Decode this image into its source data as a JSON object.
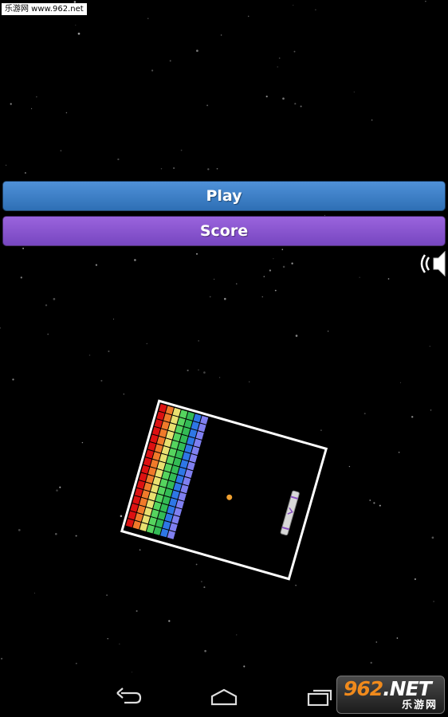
{
  "watermark": {
    "top_text": "乐游网 www.962.net",
    "badge_main": "962",
    "badge_net": ".NET",
    "badge_sub": "乐游网"
  },
  "menu": {
    "play_label": "Play",
    "score_label": "Score"
  },
  "sound": {
    "icon": "speaker-on-icon",
    "enabled": true
  },
  "preview": {
    "brick_colors": [
      "#dd1111",
      "#f07a2a",
      "#e9e070",
      "#55d45e",
      "#33bb55",
      "#2e77e6",
      "#7f7ff0"
    ],
    "ball_color": "#f0a030",
    "paddle_color": "#d8d8d8",
    "border_color": "#ffffff"
  },
  "nav": {
    "back_icon": "back-icon",
    "home_icon": "home-icon",
    "recents_icon": "recent-apps-icon"
  }
}
